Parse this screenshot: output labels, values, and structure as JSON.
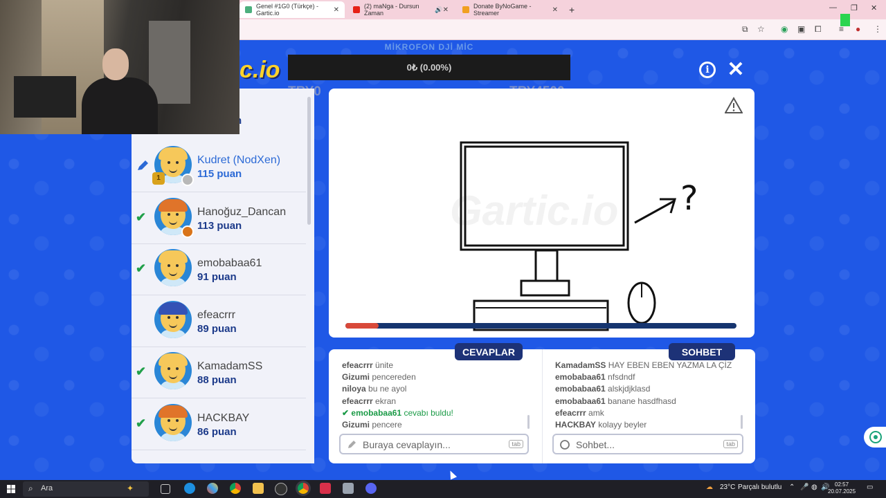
{
  "browser": {
    "tabs": [
      {
        "title": "Genel #1G0 (Türkçe) - Gartic.io",
        "fav_color": "#4caf7d",
        "active": true
      },
      {
        "title": "(2) maNga - Dursun Zaman",
        "fav_color": "#e62117",
        "active": false
      },
      {
        "title": "Donate ByNoGame - Streamer",
        "fav_color": "#f0a020",
        "active": false
      }
    ],
    "new_tab": "+",
    "minimize": "—",
    "maximize": "❐",
    "close": "✕"
  },
  "header": {
    "logo_fragment": "c.io",
    "ad_title": "MİKROFON DJİ MİC",
    "ad_progress": "0₺ (0.00%)",
    "goal_left": "TRY0",
    "goal_right": "TRY4500"
  },
  "players": {
    "partial_top_score": "n",
    "list": [
      {
        "name": "Kudret (NodXen)",
        "score": "115 puan",
        "status": "drawing",
        "hair": "#f6c85a",
        "dot": "#b8b8b8",
        "trophy": "1"
      },
      {
        "name": "Hanoğuz_Dancan",
        "score": "113 puan",
        "status": "guessed",
        "hair": "#e0742a",
        "dot": "#d9741a"
      },
      {
        "name": "emobabaa61",
        "score": "91 puan",
        "status": "guessed",
        "hair": "#f6c85a"
      },
      {
        "name": "efeacrrr",
        "score": "89 puan",
        "status": "none",
        "hair": "#3452b5"
      },
      {
        "name": "KamadamSS",
        "score": "88 puan",
        "status": "guessed",
        "hair": "#f6c85a"
      },
      {
        "name": "HACKBAY",
        "score": "86 puan",
        "status": "guessed",
        "hair": "#e0742a"
      }
    ]
  },
  "canvas": {
    "watermark": "Gartic.io",
    "question_mark": "?",
    "timer_fraction": 0.085
  },
  "answers": {
    "tag": "CEVAPLAR",
    "placeholder": "Buraya cevaplayın...",
    "tab_key": "tab",
    "messages": [
      {
        "user": "efeacrrr",
        "text": "ünite"
      },
      {
        "user": "Gizumi",
        "text": "pencereden"
      },
      {
        "user": "niloya",
        "text": "bu ne ayol"
      },
      {
        "user": "efeacrrr",
        "text": "ekran"
      },
      {
        "user": "emobabaa61",
        "text": "cevabı buldu!",
        "correct": true
      },
      {
        "user": "Gizumi",
        "text": "pencere"
      }
    ]
  },
  "chat": {
    "tag": "SOHBET",
    "placeholder": "Sohbet...",
    "tab_key": "tab",
    "messages": [
      {
        "user": "KamadamSS",
        "text": "HAY EBEN EBEN YAZMA LA ÇİZ"
      },
      {
        "user": "emobabaa61",
        "text": "nfsdndf"
      },
      {
        "user": "emobabaa61",
        "text": "alskjdjklasd"
      },
      {
        "user": "emobabaa61",
        "text": "banane hasdfhasd"
      },
      {
        "user": "efeacrrr",
        "text": "amk"
      },
      {
        "user": "HACKBAY",
        "text": "kolayy beyler"
      }
    ]
  },
  "taskbar": {
    "search_label": "Ara",
    "weather": "23°C",
    "weather_desc": "Parçalı bulutlu",
    "time": "02:57",
    "date": "20.07.2025"
  }
}
